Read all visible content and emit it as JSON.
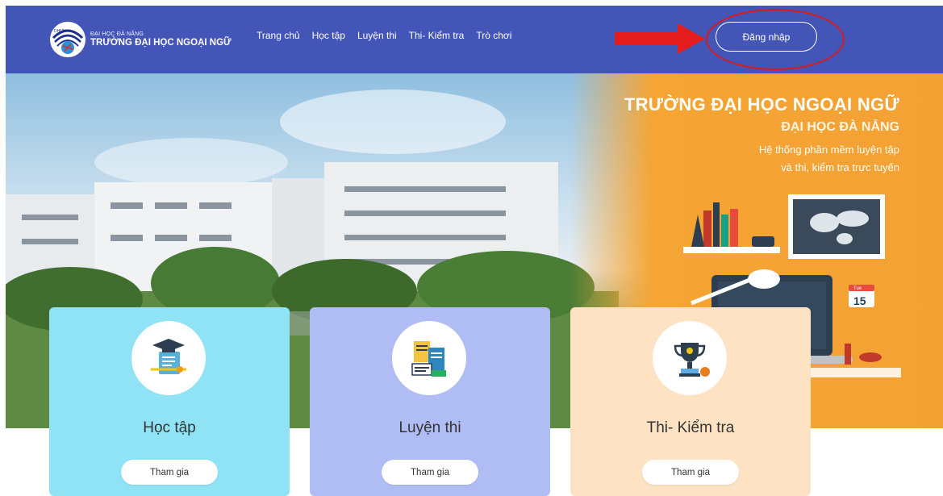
{
  "header": {
    "logo": {
      "small_text": "ĐẠI HỌC ĐÀ NẴNG",
      "big_text": "TRƯỜNG ĐẠI HỌC NGOẠI NGỮ",
      "badge_text": "DHNN"
    },
    "nav": [
      {
        "label": "Trang chủ"
      },
      {
        "label": "Học tập"
      },
      {
        "label": "Luyện thi"
      },
      {
        "label": "Thi- Kiểm tra"
      },
      {
        "label": "Trò chơi"
      }
    ],
    "login_label": "Đăng nhập",
    "annotation_color": "#d91b1b"
  },
  "hero": {
    "title": "TRƯỜNG ĐẠI HỌC NGOẠI NGỮ",
    "subtitle": "ĐẠI HỌC ĐÀ NẴNG",
    "tagline_line1": "Hệ thống phần mềm luyện tập",
    "tagline_line2": "và thi, kiểm tra trực tuyến",
    "calendar_number": "15",
    "calendar_day": "Tue"
  },
  "cards": [
    {
      "title": "Học tập",
      "button": "Tham gia",
      "icon": "graduation-scroll-icon",
      "color": "#8fe3f5"
    },
    {
      "title": "Luyện thi",
      "button": "Tham gia",
      "icon": "books-notes-icon",
      "color": "#b0bdf4"
    },
    {
      "title": "Thi- Kiểm tra",
      "button": "Tham gia",
      "icon": "trophy-icon",
      "color": "#fde3c4"
    }
  ],
  "colors": {
    "header": "#4455b8",
    "hero_orange": "#f5a534"
  }
}
